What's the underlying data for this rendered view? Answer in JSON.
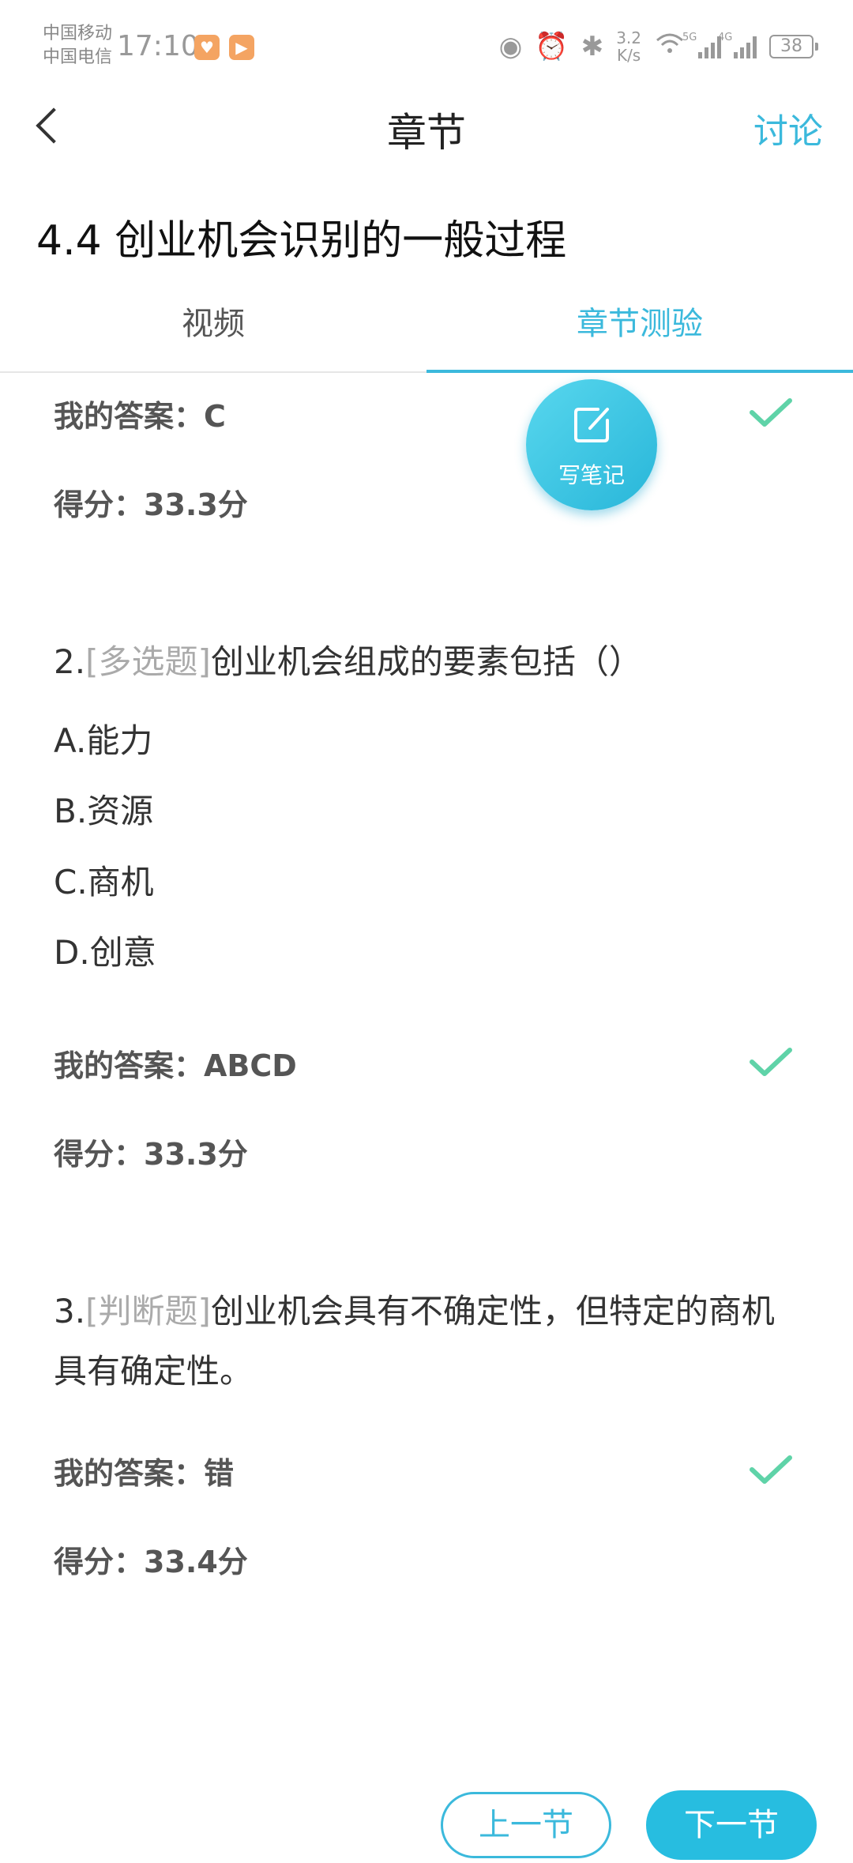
{
  "status_bar": {
    "carrier1": "中国移动",
    "carrier2": "中国电信",
    "time": "17:10",
    "speed_value": "3.2",
    "speed_unit": "K/s",
    "signal1_tag": "5G",
    "signal2_tag": "4G",
    "battery": "38"
  },
  "header": {
    "title": "章节",
    "right_action": "讨论"
  },
  "chapter_title": "4.4 创业机会识别的一般过程",
  "tabs": [
    {
      "label": "视频",
      "active": false
    },
    {
      "label": "章节测验",
      "active": true
    }
  ],
  "quiz": {
    "q1": {
      "my_answer_label": "我的答案：C",
      "score_label": "得分：33.3分"
    },
    "q2": {
      "number": "2.",
      "type": "[多选题]",
      "text": "创业机会组成的要素包括（）",
      "options": [
        "A.能力",
        "B.资源",
        "C.商机",
        "D.创意"
      ],
      "my_answer_label": "我的答案：ABCD",
      "score_label": "得分：33.3分"
    },
    "q3": {
      "number": "3.",
      "type": "[判断题]",
      "text": "创业机会具有不确定性，但特定的商机具有确定性。",
      "my_answer_label": "我的答案：错",
      "score_label": "得分：33.4分"
    }
  },
  "note_button": {
    "label": "写笔记",
    "icon": "edit-note-icon"
  },
  "footer": {
    "prev_label": "上一节",
    "next_label": "下一节"
  },
  "colors": {
    "accent": "#3bb9dc",
    "check": "#5fd3a8"
  }
}
